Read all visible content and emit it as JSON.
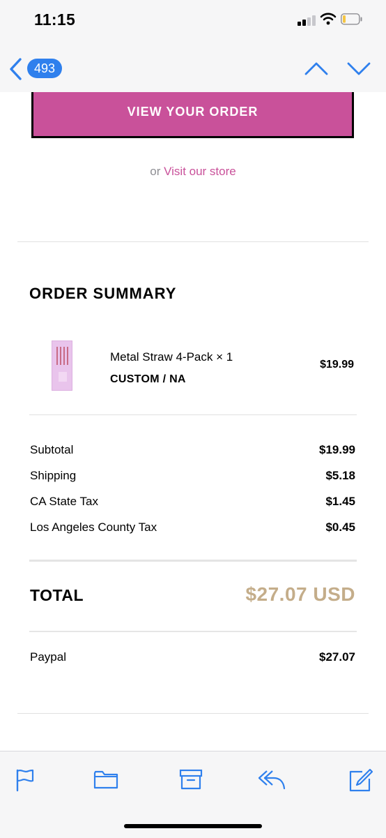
{
  "status_bar": {
    "time": "11:15",
    "signal_bars": 4,
    "signal_bars_active": 2,
    "battery_level": 0.12,
    "battery_color": "#f5c542"
  },
  "nav": {
    "back_icon": "chevron-left-icon",
    "unread_count": "493",
    "prev_icon": "chevron-up-icon",
    "next_icon": "chevron-down-icon",
    "accent_color": "#2f80ed"
  },
  "email": {
    "view_order_label": "VIEW YOUR ORDER",
    "store_prefix": "or",
    "store_link_label": "Visit our store",
    "brand_color": "#c9519a",
    "order_summary_title": "ORDER SUMMARY",
    "item": {
      "name": "Metal Straw 4-Pack × 1",
      "variant": "CUSTOM / NA",
      "price": "$19.99"
    },
    "lines": [
      {
        "label": "Subtotal",
        "value": "$19.99"
      },
      {
        "label": "Shipping",
        "value": "$5.18"
      },
      {
        "label": "CA State Tax",
        "value": "$1.45"
      },
      {
        "label": "Los Angeles County Tax",
        "value": "$0.45"
      }
    ],
    "total_label": "TOTAL",
    "total_value": "$27.07 USD",
    "total_color": "#c4ad8a",
    "payment": {
      "method": "Paypal",
      "amount": "$27.07"
    }
  },
  "toolbar": {
    "items": [
      {
        "icon": "flag-icon"
      },
      {
        "icon": "folder-icon"
      },
      {
        "icon": "archive-icon"
      },
      {
        "icon": "reply-icon"
      },
      {
        "icon": "compose-icon"
      }
    ]
  }
}
